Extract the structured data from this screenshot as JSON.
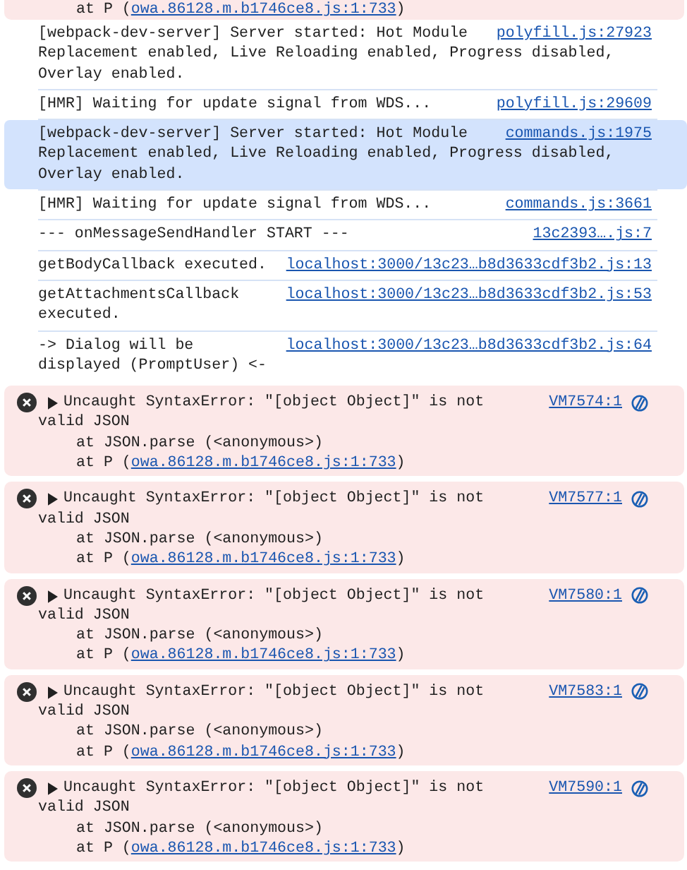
{
  "messages": [
    {
      "kind": "error-tail",
      "stack": [
        {
          "prefix": "at P (",
          "link": "owa.86128.m.b1746ce8.js:1:733",
          "suffix": ")"
        }
      ]
    },
    {
      "kind": "log",
      "text": "[webpack-dev-server] Server started: Hot Module Replacement enabled, Live Reloading enabled, Progress disabled, Overlay enabled.",
      "source": "polyfill.js:27923",
      "selected": false
    },
    {
      "kind": "log",
      "text": "[HMR] Waiting for update signal from WDS...",
      "source": "polyfill.js:29609",
      "selected": false
    },
    {
      "kind": "log",
      "text": "[webpack-dev-server] Server started: Hot Module Replacement enabled, Live Reloading enabled, Progress disabled, Overlay enabled.",
      "source": "commands.js:1975",
      "selected": true
    },
    {
      "kind": "log",
      "text": "[HMR] Waiting for update signal from WDS...",
      "source": "commands.js:3661",
      "selected": false
    },
    {
      "kind": "log",
      "text": "--- onMessageSendHandler START ---",
      "source": "13c2393….js:7",
      "selected": false
    },
    {
      "kind": "log",
      "text": "getBodyCallback executed.",
      "source": "localhost:3000/13c23…b8d3633cdf3b2.js:13",
      "selected": false
    },
    {
      "kind": "log",
      "text": "getAttachmentsCallback executed.",
      "source": "localhost:3000/13c23…b8d3633cdf3b2.js:53",
      "selected": false
    },
    {
      "kind": "log",
      "text": "-> Dialog will be displayed (PromptUser) <-",
      "source": "localhost:3000/13c23…b8d3633cdf3b2.js:64",
      "selected": false
    },
    {
      "kind": "error",
      "text": "Uncaught SyntaxError: \"[object Object]\" is not valid JSON",
      "source": "VM7574:1",
      "expanded": false,
      "stack": [
        {
          "prefix": "at JSON.parse (<anonymous>)"
        },
        {
          "prefix": "at P (",
          "link": "owa.86128.m.b1746ce8.js:1:733",
          "suffix": ")"
        }
      ]
    },
    {
      "kind": "error",
      "text": "Uncaught SyntaxError: \"[object Object]\" is not valid JSON",
      "source": "VM7577:1",
      "expanded": false,
      "stack": [
        {
          "prefix": "at JSON.parse (<anonymous>)"
        },
        {
          "prefix": "at P (",
          "link": "owa.86128.m.b1746ce8.js:1:733",
          "suffix": ")"
        }
      ]
    },
    {
      "kind": "error",
      "text": "Uncaught SyntaxError: \"[object Object]\" is not valid JSON",
      "source": "VM7580:1",
      "expanded": false,
      "stack": [
        {
          "prefix": "at JSON.parse (<anonymous>)"
        },
        {
          "prefix": "at P (",
          "link": "owa.86128.m.b1746ce8.js:1:733",
          "suffix": ")"
        }
      ]
    },
    {
      "kind": "error",
      "text": "Uncaught SyntaxError: \"[object Object]\" is not valid JSON",
      "source": "VM7583:1",
      "expanded": false,
      "stack": [
        {
          "prefix": "at JSON.parse (<anonymous>)"
        },
        {
          "prefix": "at P (",
          "link": "owa.86128.m.b1746ce8.js:1:733",
          "suffix": ")"
        }
      ]
    },
    {
      "kind": "error",
      "text": "Uncaught SyntaxError: \"[object Object]\" is not valid JSON",
      "source": "VM7590:1",
      "expanded": false,
      "stack": [
        {
          "prefix": "at JSON.parse (<anonymous>)"
        },
        {
          "prefix": "at P (",
          "link": "owa.86128.m.b1746ce8.js:1:733",
          "suffix": ")"
        }
      ]
    }
  ]
}
